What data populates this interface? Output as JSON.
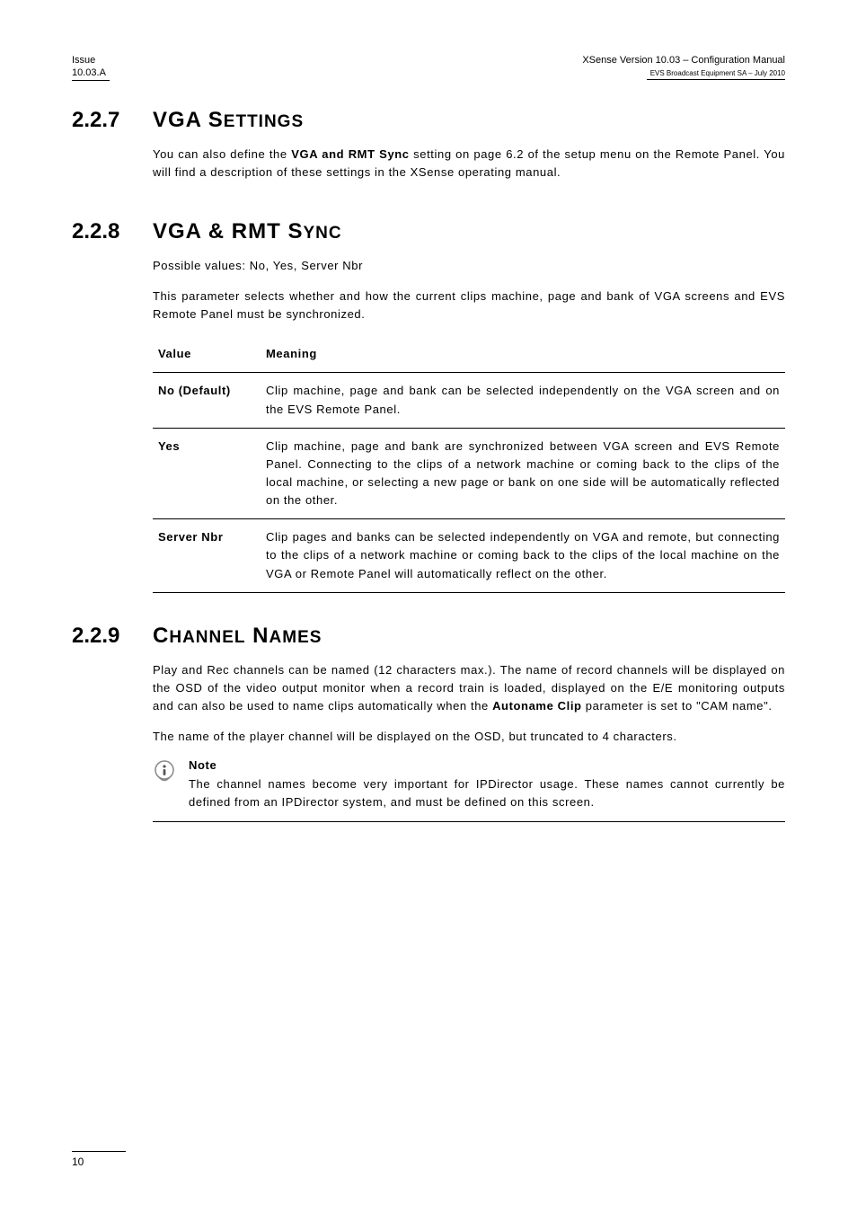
{
  "header": {
    "left_line1": "Issue",
    "left_line2": "10.03.A",
    "right_line1": "XSense    Version 10.03 – Configuration Manual",
    "right_line2": "EVS Broadcast Equipment SA – July 2010"
  },
  "sections": {
    "s227": {
      "num": "2.2.7",
      "title_main": "VGA S",
      "title_sc": "ETTINGS",
      "para1_a": "You can also define the ",
      "para1_bold": "VGA and RMT Sync",
      "para1_b": " setting on page 6.2 of the setup menu on the Remote Panel. You will find a description of these settings in the XSense operating manual."
    },
    "s228": {
      "num": "2.2.8",
      "title_main": "VGA & RMT S",
      "title_sc": "YNC",
      "para1": "Possible values: No, Yes, Server Nbr",
      "para2": "This parameter selects whether and how the current clips machine, page and bank of VGA screens and EVS Remote Panel must be synchronized.",
      "th_value": "Value",
      "th_meaning": "Meaning",
      "rows": [
        {
          "value": "No (Default)",
          "meaning": "Clip machine, page and bank can be selected independently on the VGA screen and on the EVS Remote Panel."
        },
        {
          "value": "Yes",
          "meaning": "Clip machine, page and bank are synchronized between VGA screen and EVS Remote Panel. Connecting to the clips of a network machine or coming back to the clips of the local machine, or selecting a new page or bank on one side will be automatically reflected on the other."
        },
        {
          "value": "Server Nbr",
          "meaning": "Clip pages and banks can be selected independently on VGA and remote, but connecting to the clips of a network machine or coming back to the clips of the local machine on the VGA or Remote Panel will automatically reflect on the other."
        }
      ]
    },
    "s229": {
      "num": "2.2.9",
      "title_main": "C",
      "title_sc1": "HANNEL",
      "title_main2": " N",
      "title_sc2": "AMES",
      "para1_a": "Play and Rec channels can be named (12 characters max.). The name of record channels will be displayed on the OSD of the video output monitor when a record train is loaded, displayed on the E/E monitoring outputs and can also be used to name clips automatically when the ",
      "para1_bold": "Autoname Clip",
      "para1_b": " parameter is set to \"CAM name\".",
      "para2": "The name of the player channel will be displayed on the OSD, but truncated to 4 characters.",
      "note_title": "Note",
      "note_body": "The channel names become very important for IPDirector usage.  These names cannot currently be defined from an IPDirector system, and must be defined on this screen."
    }
  },
  "footer": {
    "page": "10"
  }
}
